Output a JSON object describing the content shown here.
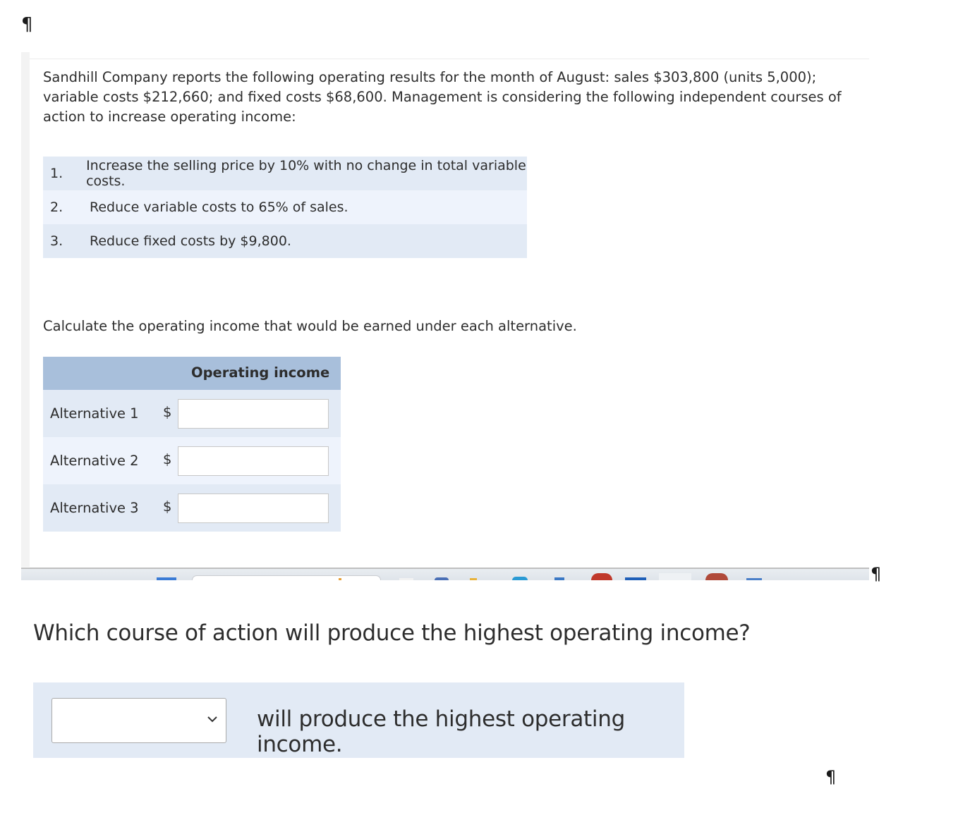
{
  "pilcrow_mark": "¶",
  "intro_text": "Sandhill Company reports the following operating results for the month of August: sales $303,800 (units 5,000); variable costs $212,660; and fixed costs $68,600. Management is considering the following independent courses of action to increase operating income:",
  "options": [
    {
      "number": "1.",
      "text": "Increase the selling price by 10% with no change in total variable costs."
    },
    {
      "number": "2.",
      "text": "Reduce variable costs to 65% of sales."
    },
    {
      "number": "3.",
      "text": "Reduce fixed costs by $9,800."
    }
  ],
  "calc_prompt": "Calculate the operating income that would be earned under each alternative.",
  "income_table": {
    "header": "Operating income",
    "rows": [
      {
        "label": "Alternative 1",
        "currency": "$",
        "value": ""
      },
      {
        "label": "Alternative 2",
        "currency": "$",
        "value": ""
      },
      {
        "label": "Alternative 3",
        "currency": "$",
        "value": ""
      }
    ]
  },
  "question": "Which course of action will produce the highest operating income?",
  "answer": {
    "selected": "",
    "suffix_text": "will produce the highest operating income."
  },
  "colors": {
    "row_odd": "#e2eaf5",
    "row_even": "#eef3fc",
    "table_header": "#a8bfdb",
    "text": "#2d2d2d"
  }
}
